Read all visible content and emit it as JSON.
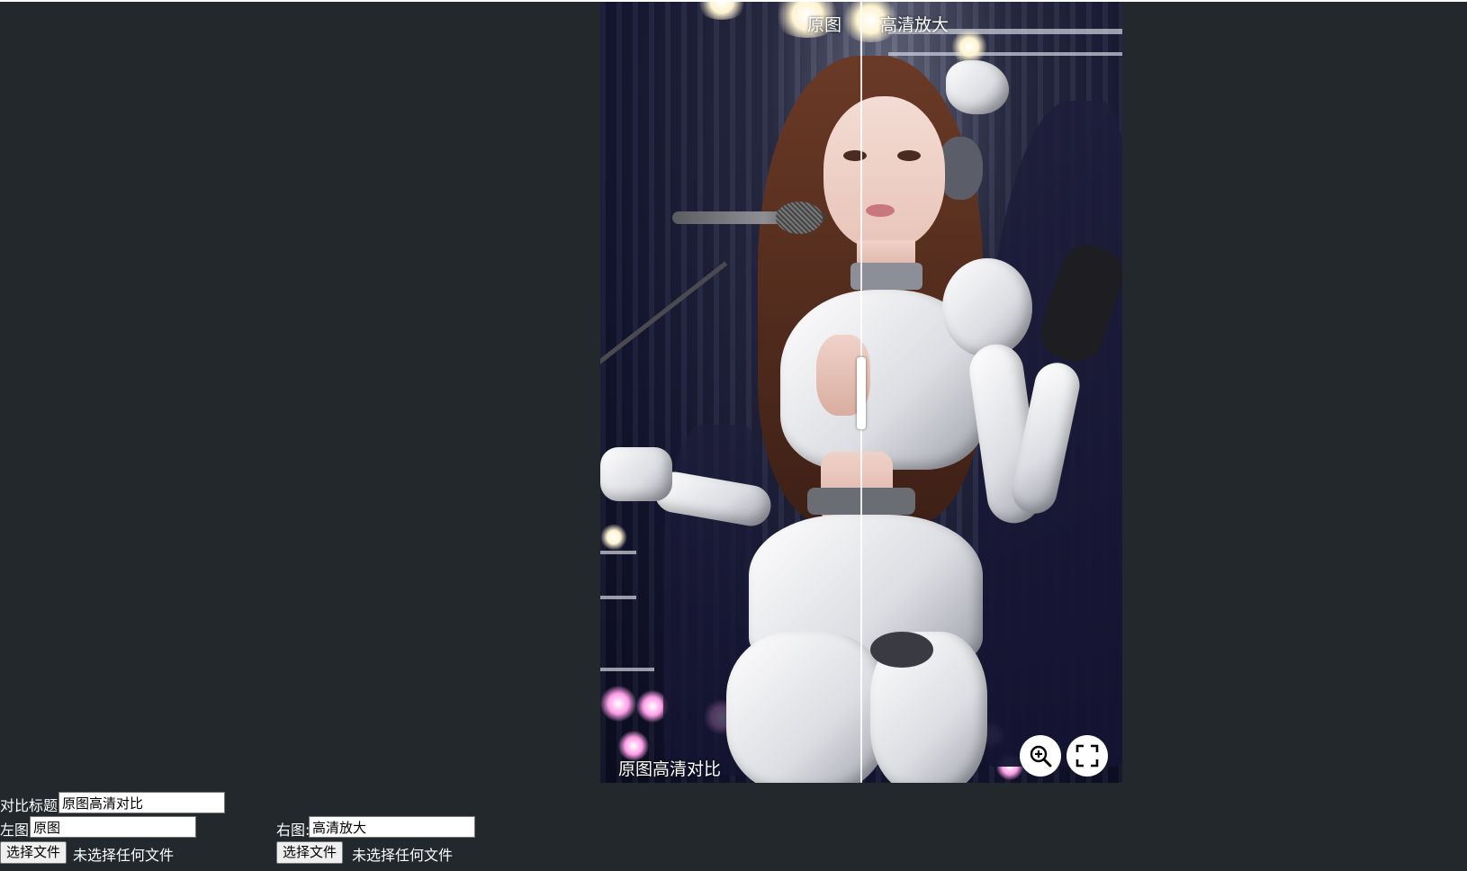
{
  "viewer": {
    "left_caption": "原图",
    "right_caption": "高清放大",
    "title": "原图高清对比",
    "divider_position": 0.5,
    "icons": {
      "zoom": "zoom-in-icon",
      "fullscreen": "fullscreen-icon"
    }
  },
  "form": {
    "title_label": "对比标题:",
    "title_value": "原图高清对比",
    "left_label": "左图:",
    "left_value": "原图",
    "right_label": "右图:",
    "right_value": "高清放大",
    "left_file_button": "选择文件",
    "left_file_status": "未选择任何文件",
    "right_file_button": "选择文件",
    "right_file_status": "未选择任何文件"
  },
  "colors": {
    "background": "#23282d",
    "button_bg": "#ffffff"
  }
}
